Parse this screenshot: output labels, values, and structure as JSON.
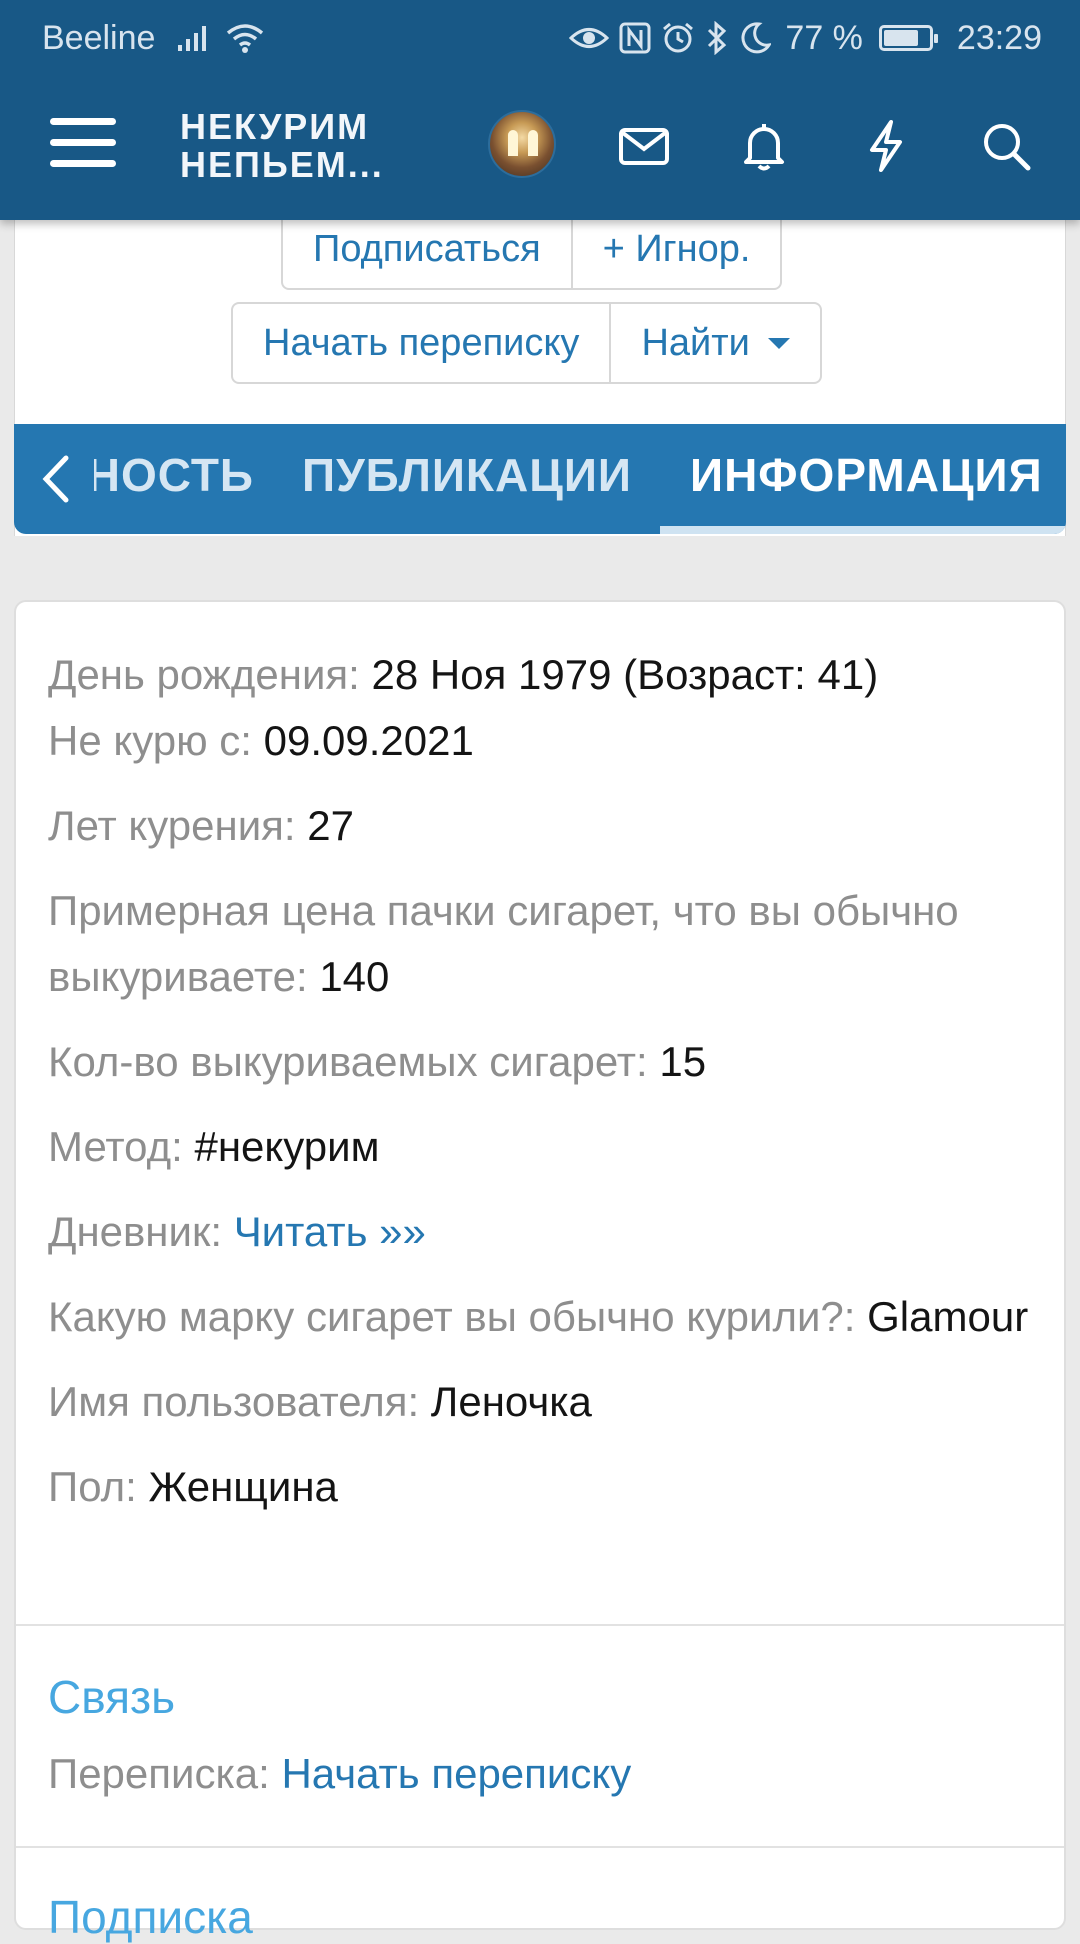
{
  "status_bar": {
    "carrier": "Beeline",
    "battery_percent": "77 %",
    "battery_level": 0.77,
    "time": "23:29",
    "icons": [
      "signal-icon",
      "wifi-icon",
      "eye-icon",
      "nfc-icon",
      "alarm-icon",
      "bluetooth-icon",
      "moon-icon",
      "battery-icon"
    ]
  },
  "header": {
    "logo_line1": "НЕКУРИМ",
    "logo_line2": "НЕПЬЕМ...",
    "icons": [
      "menu-icon",
      "avatar",
      "mail-icon",
      "bell-icon",
      "lightning-icon",
      "search-icon"
    ],
    "background": "#185886"
  },
  "profile_actions": {
    "subscribe": "Подписаться",
    "ignore": "+ Игнор.",
    "start_conversation": "Начать переписку",
    "find": "Найти"
  },
  "tabs": {
    "items": [
      "НОСТЬ",
      "ПУБЛИКАЦИИ",
      "ИНФОРМАЦИЯ"
    ],
    "active": "ИНФОРМАЦИЯ",
    "color": "#2577b1"
  },
  "info": {
    "birthday": {
      "label": "День рождения:",
      "value": "28 Ноя 1979 (Возраст: 41)"
    },
    "not_smoking_since": {
      "label": "Не курю с:",
      "value": "09.09.2021"
    },
    "years_smoking": {
      "label": "Лет курения:",
      "value": "27"
    },
    "pack_price": {
      "label": "Примерная цена пачки сигарет, что вы обычно выкуриваете:",
      "value": "140"
    },
    "cigarettes_count": {
      "label": "Кол-во выкуриваемых сигарет:",
      "value": "15"
    },
    "method": {
      "label": "Метод:",
      "value": "#некурим"
    },
    "diary": {
      "label": "Дневник:",
      "value": "Читать »»"
    },
    "brand": {
      "label": "Какую марку сигарет вы обычно курили?:",
      "value": "Glamour"
    },
    "username": {
      "label": "Имя пользователя:",
      "value": "Леночка"
    },
    "gender": {
      "label": "Пол:",
      "value": "Женщина"
    }
  },
  "contact": {
    "title": "Связь",
    "label": "Переписка:",
    "link": "Начать переписку"
  },
  "subscription": {
    "title": "Подписка"
  }
}
